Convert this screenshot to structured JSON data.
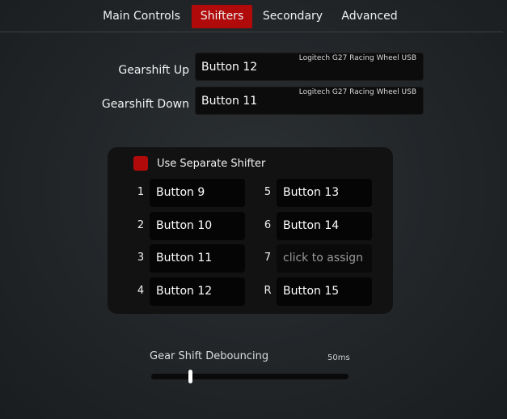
{
  "tabs": [
    {
      "label": "Main Controls",
      "active": false
    },
    {
      "label": "Shifters",
      "active": true
    },
    {
      "label": "Secondary",
      "active": false
    },
    {
      "label": "Advanced",
      "active": false
    }
  ],
  "shift_bindings": {
    "up": {
      "label": "Gearshift Up",
      "value": "Button 12",
      "device": "Logitech G27 Racing Wheel USB"
    },
    "down": {
      "label": "Gearshift Down",
      "value": "Button 11",
      "device": "Logitech G27 Racing Wheel USB"
    }
  },
  "separate_shifter": {
    "checkbox_label": "Use Separate Shifter",
    "checked": true,
    "gears": [
      {
        "num": "1",
        "value": "Button 9"
      },
      {
        "num": "2",
        "value": "Button 10"
      },
      {
        "num": "3",
        "value": "Button 11"
      },
      {
        "num": "4",
        "value": "Button 12"
      },
      {
        "num": "5",
        "value": "Button 13"
      },
      {
        "num": "6",
        "value": "Button 14"
      },
      {
        "num": "7",
        "value": "click to assign"
      },
      {
        "num": "R",
        "value": "Button 15"
      }
    ]
  },
  "debounce": {
    "label": "Gear Shift Debouncing",
    "value_text": "50ms",
    "level": 0.2
  },
  "colors": {
    "accent": "#b00a0a",
    "field_bg": "#0c0c0c",
    "panel_bg": "#121212"
  }
}
